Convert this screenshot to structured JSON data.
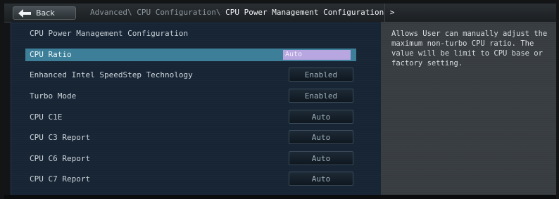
{
  "topbar": {
    "back_label": "Back",
    "breadcrumb": [
      "Advanced\\",
      "CPU Configuration\\",
      "CPU Power Management Configuration"
    ],
    "breadcrumb_arrow": ">"
  },
  "page": {
    "title": "CPU Power Management Configuration"
  },
  "settings": [
    {
      "label": "CPU Ratio",
      "value": "Auto",
      "selected": true
    },
    {
      "label": "Enhanced Intel SpeedStep Technology",
      "value": "Enabled"
    },
    {
      "label": "Turbo Mode",
      "value": "Enabled"
    },
    {
      "label": "CPU C1E",
      "value": "Auto"
    },
    {
      "label": "CPU C3 Report",
      "value": "Auto"
    },
    {
      "label": "CPU C6 Report",
      "value": "Auto"
    },
    {
      "label": "CPU C7 Report",
      "value": "Auto"
    }
  ],
  "help": {
    "text": "Allows User can manually adjust the maximum non-turbo CPU ratio. The value will be limit to CPU base or factory setting."
  },
  "colors": {
    "selected_row": "#3d7f99",
    "input_highlight": "#b7a6df",
    "main_panel": "#162434",
    "help_panel": "#3a3f43"
  },
  "icons": {
    "back": "back-arrow-icon"
  }
}
